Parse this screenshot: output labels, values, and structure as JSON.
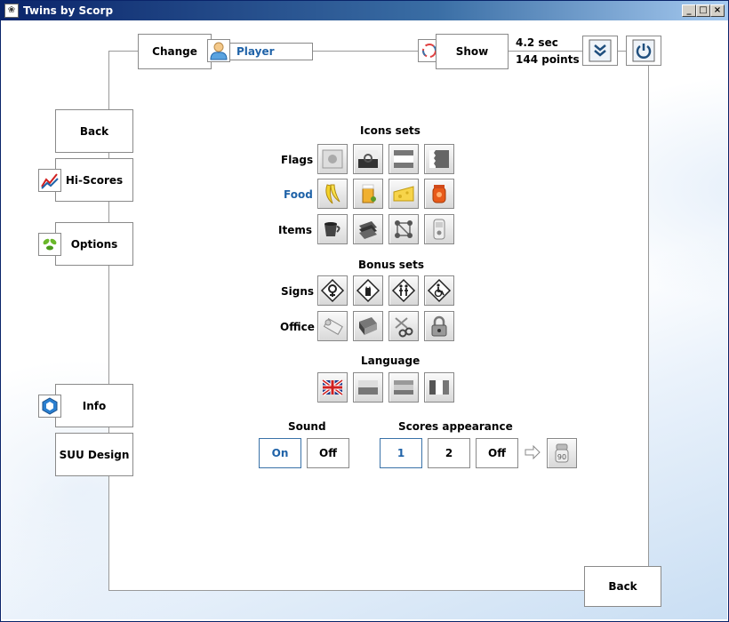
{
  "window": {
    "title": "Twins by Scorp",
    "app_icon": "twins-app-icon",
    "controls": [
      "minimize",
      "maximize",
      "close"
    ]
  },
  "top_bar": {
    "change_label": "Change",
    "player_name": "Player",
    "player_icon": "user-icon",
    "show_label": "Show",
    "show_icon": "spinner-icon",
    "time": "4.2 sec",
    "points": "144 points",
    "collapse_icon": "double-chevron-down-icon",
    "power_icon": "power-icon"
  },
  "sidebar": {
    "back_label": "Back",
    "hiscores_label": "Hi-Scores",
    "options_label": "Options",
    "info_label": "Info",
    "suu_label": "SUU Design"
  },
  "icon_sets": {
    "heading": "Icons sets",
    "rows": [
      {
        "label": "Flags",
        "selected": false,
        "icons": [
          "flag-1-icon",
          "flag-2-icon",
          "flag-3-icon",
          "flag-4-icon"
        ]
      },
      {
        "label": "Food",
        "selected": true,
        "icons": [
          "banana-icon",
          "beer-icon",
          "cheese-icon",
          "jam-jar-icon"
        ]
      },
      {
        "label": "Items",
        "selected": false,
        "icons": [
          "cup-icon",
          "books-icon",
          "molecule-icon",
          "cell-phone-icon"
        ]
      }
    ]
  },
  "bonus_sets": {
    "heading": "Bonus sets",
    "rows": [
      {
        "label": "Signs",
        "icons": [
          "female-sign-icon",
          "cat-sign-icon",
          "pedestrians-sign-icon",
          "wheelchair-sign-icon"
        ]
      },
      {
        "label": "Office",
        "icons": [
          "scroll-icon",
          "notebook-icon",
          "scissors-icon",
          "padlock-icon"
        ]
      }
    ]
  },
  "language": {
    "heading": "Language",
    "icons": [
      "uk-flag-icon",
      "language-2-icon",
      "language-3-icon",
      "language-4-icon"
    ]
  },
  "sound": {
    "heading": "Sound",
    "on_label": "On",
    "off_label": "Off",
    "selected": "On"
  },
  "scores_appearance": {
    "heading": "Scores appearance",
    "option_1": "1",
    "option_2": "2",
    "option_off": "Off",
    "selected": "1",
    "arrow_icon": "right-arrow-icon",
    "preview_icon": "score-preview-icon"
  },
  "footer": {
    "back_label": "Back"
  },
  "colors": {
    "accent": "#2063a8",
    "title_bar": "#0a246a"
  }
}
